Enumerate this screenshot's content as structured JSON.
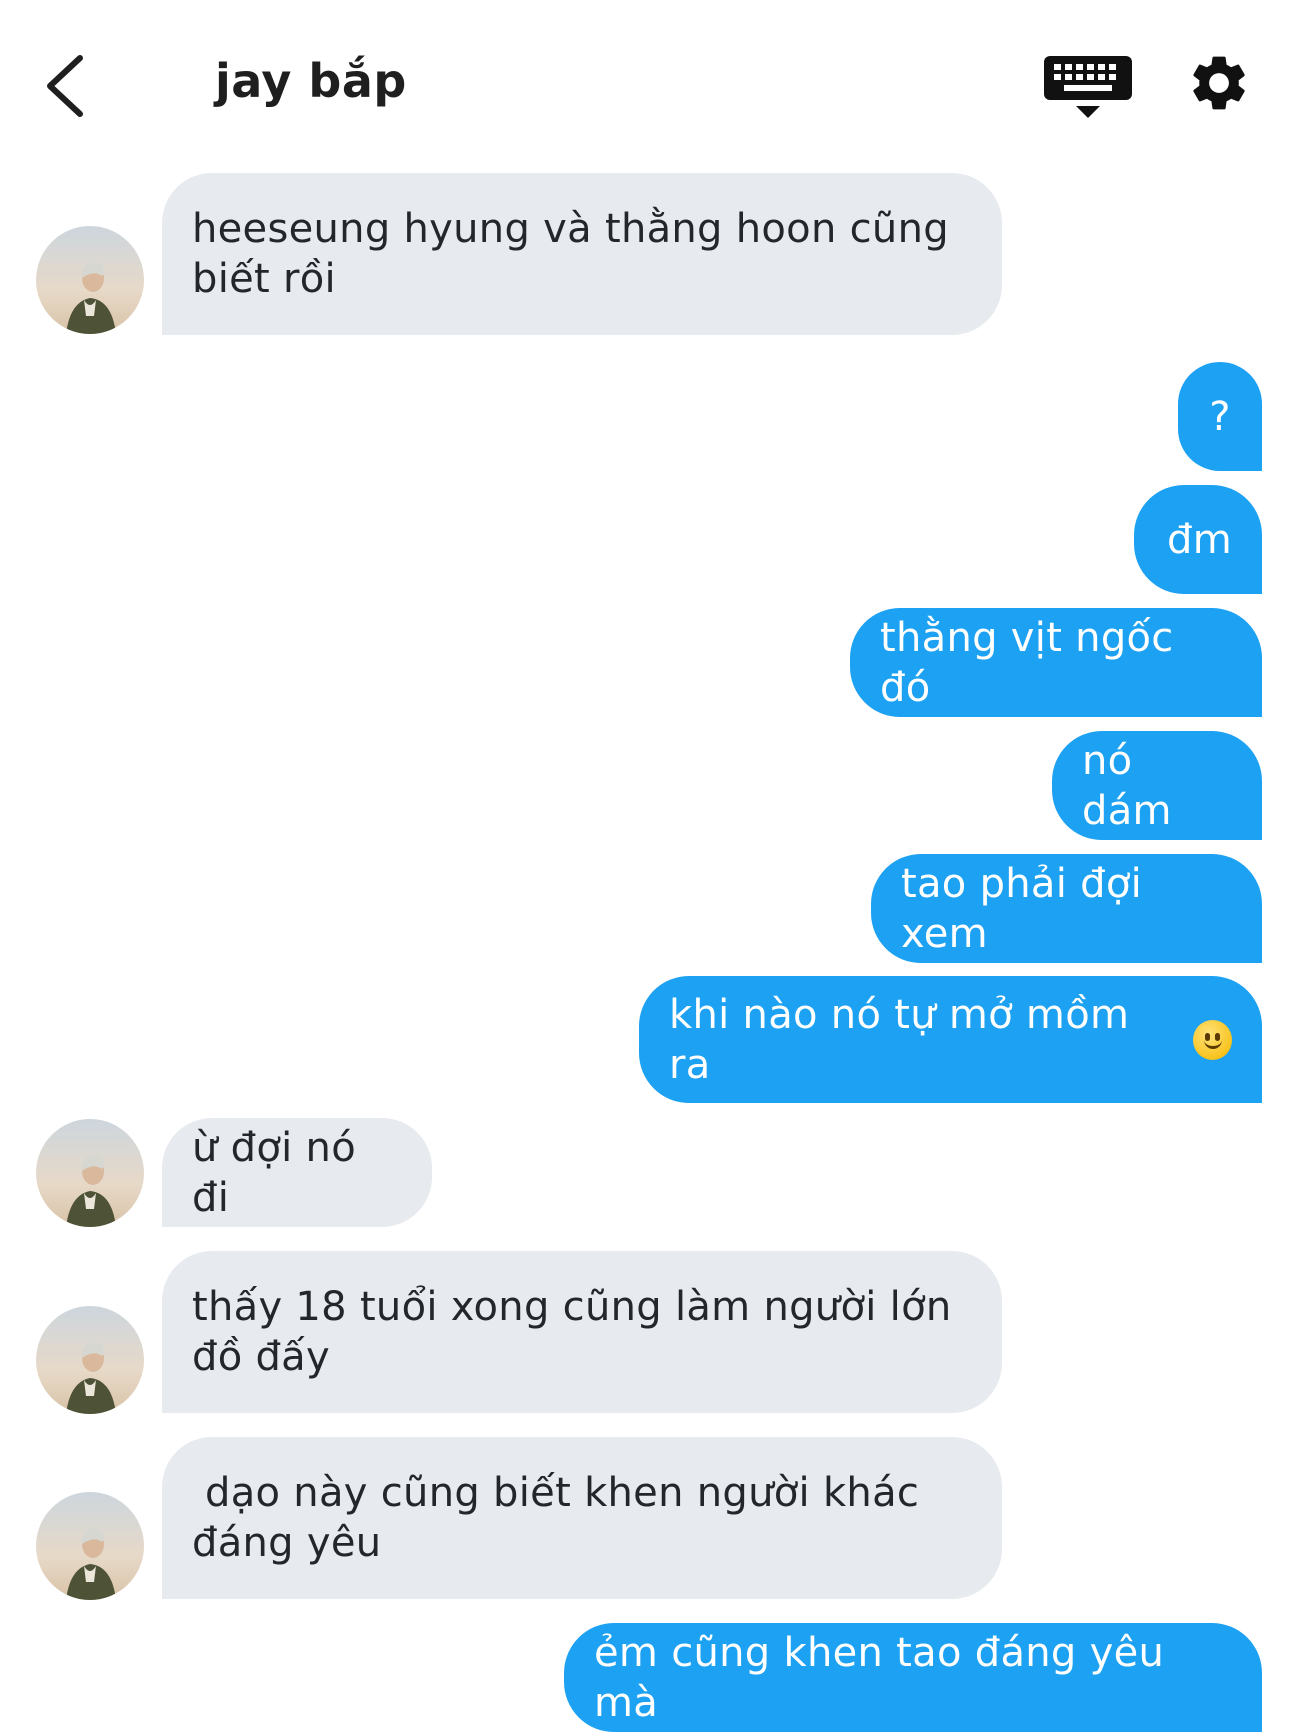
{
  "header": {
    "title": "jay bắp",
    "back_icon": "chevron-left-icon",
    "keyboard_icon": "keyboard-icon",
    "settings_icon": "gear-icon"
  },
  "colors": {
    "outgoing_bubble": "#1da1f2",
    "incoming_bubble": "#e7eaee"
  },
  "messages": [
    {
      "direction": "incoming",
      "text": "heeseung hyung và thằng hoon cũng\nbiết rồi"
    },
    {
      "direction": "outgoing",
      "text": "?"
    },
    {
      "direction": "outgoing",
      "text": "đm"
    },
    {
      "direction": "outgoing",
      "text": "thằng vịt ngốc đó"
    },
    {
      "direction": "outgoing",
      "text": "nó dám"
    },
    {
      "direction": "outgoing",
      "text": "tao phải đợi xem"
    },
    {
      "direction": "outgoing",
      "text": "khi nào nó tự mở mồm ra",
      "emoji": "slightly-smiling-face"
    },
    {
      "direction": "incoming",
      "text": "ừ đợi nó đi"
    },
    {
      "direction": "incoming",
      "text": "thấy 18 tuổi xong cũng làm người lớn\nđồ đấy"
    },
    {
      "direction": "incoming",
      "text": " dạo này cũng biết khen người khác\nđáng yêu"
    },
    {
      "direction": "outgoing",
      "text": "ẻm cũng khen tao đáng yêu mà"
    }
  ]
}
